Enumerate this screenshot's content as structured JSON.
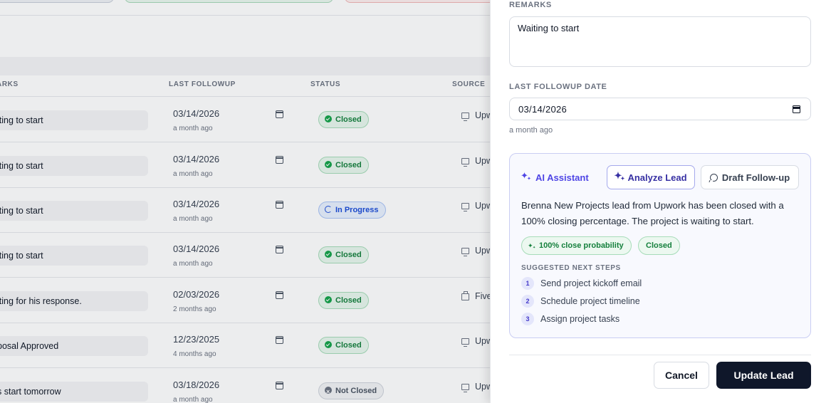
{
  "table": {
    "headers": {
      "remarks": "ARKS",
      "last_followup": "LAST FOLLOWUP",
      "status": "STATUS",
      "source": "SOURCE"
    },
    "rows": [
      {
        "remark": "iting to start",
        "date": "03/14/2026",
        "ago": "a month ago",
        "status": "Closed",
        "source": "Upw"
      },
      {
        "remark": "iting to start",
        "date": "03/14/2026",
        "ago": "a month ago",
        "status": "Closed",
        "source": "Upw"
      },
      {
        "remark": "iting to start",
        "date": "03/14/2026",
        "ago": "a month ago",
        "status": "In Progress",
        "source": "Upw"
      },
      {
        "remark": "iting to start",
        "date": "03/14/2026",
        "ago": "a month ago",
        "status": "Closed",
        "source": "Upw"
      },
      {
        "remark": "iting for his response.",
        "date": "02/03/2026",
        "ago": "2 months ago",
        "status": "Closed",
        "source": "Five"
      },
      {
        "remark": "posal Approved",
        "date": "12/23/2025",
        "ago": "4 months ago",
        "status": "Closed",
        "source": "Upw"
      },
      {
        "remark": "s start tomorrow",
        "date": "03/18/2026",
        "ago": "a month ago",
        "status": "Not Closed",
        "source": "Upw"
      }
    ]
  },
  "drawer": {
    "remarks_label": "REMARKS",
    "remarks_value": "Waiting to start",
    "followup_label": "LAST FOLLOWUP DATE",
    "followup_value": "03/14/2026",
    "followup_ago": "a month ago",
    "ai": {
      "title": "AI Assistant",
      "analyze_label": "Analyze Lead",
      "draft_label": "Draft Follow-up",
      "summary": "Brenna New Projects lead from Upwork has been closed with a 100% closing percentage. The project is waiting to start.",
      "probability_chip": "100% close probability",
      "status_chip": "Closed",
      "next_steps_label": "SUGGESTED NEXT STEPS",
      "steps": [
        {
          "num": "1",
          "text": "Send project kickoff email"
        },
        {
          "num": "2",
          "text": "Schedule project timeline"
        },
        {
          "num": "3",
          "text": "Assign project tasks"
        }
      ]
    },
    "cancel_label": "Cancel",
    "update_label": "Update Lead"
  },
  "colors": {
    "accent": "#4f46e5",
    "primary_button": "#0f172a",
    "success": "#15803d",
    "info": "#1d4ed8",
    "neutral": "#4b5563"
  },
  "icons": {
    "ai": "sparkles-icon",
    "calendar": "calendar-icon",
    "draft": "message-circle-icon",
    "source_upwork": "monitor-icon",
    "source_fiverr": "briefcase-icon"
  }
}
